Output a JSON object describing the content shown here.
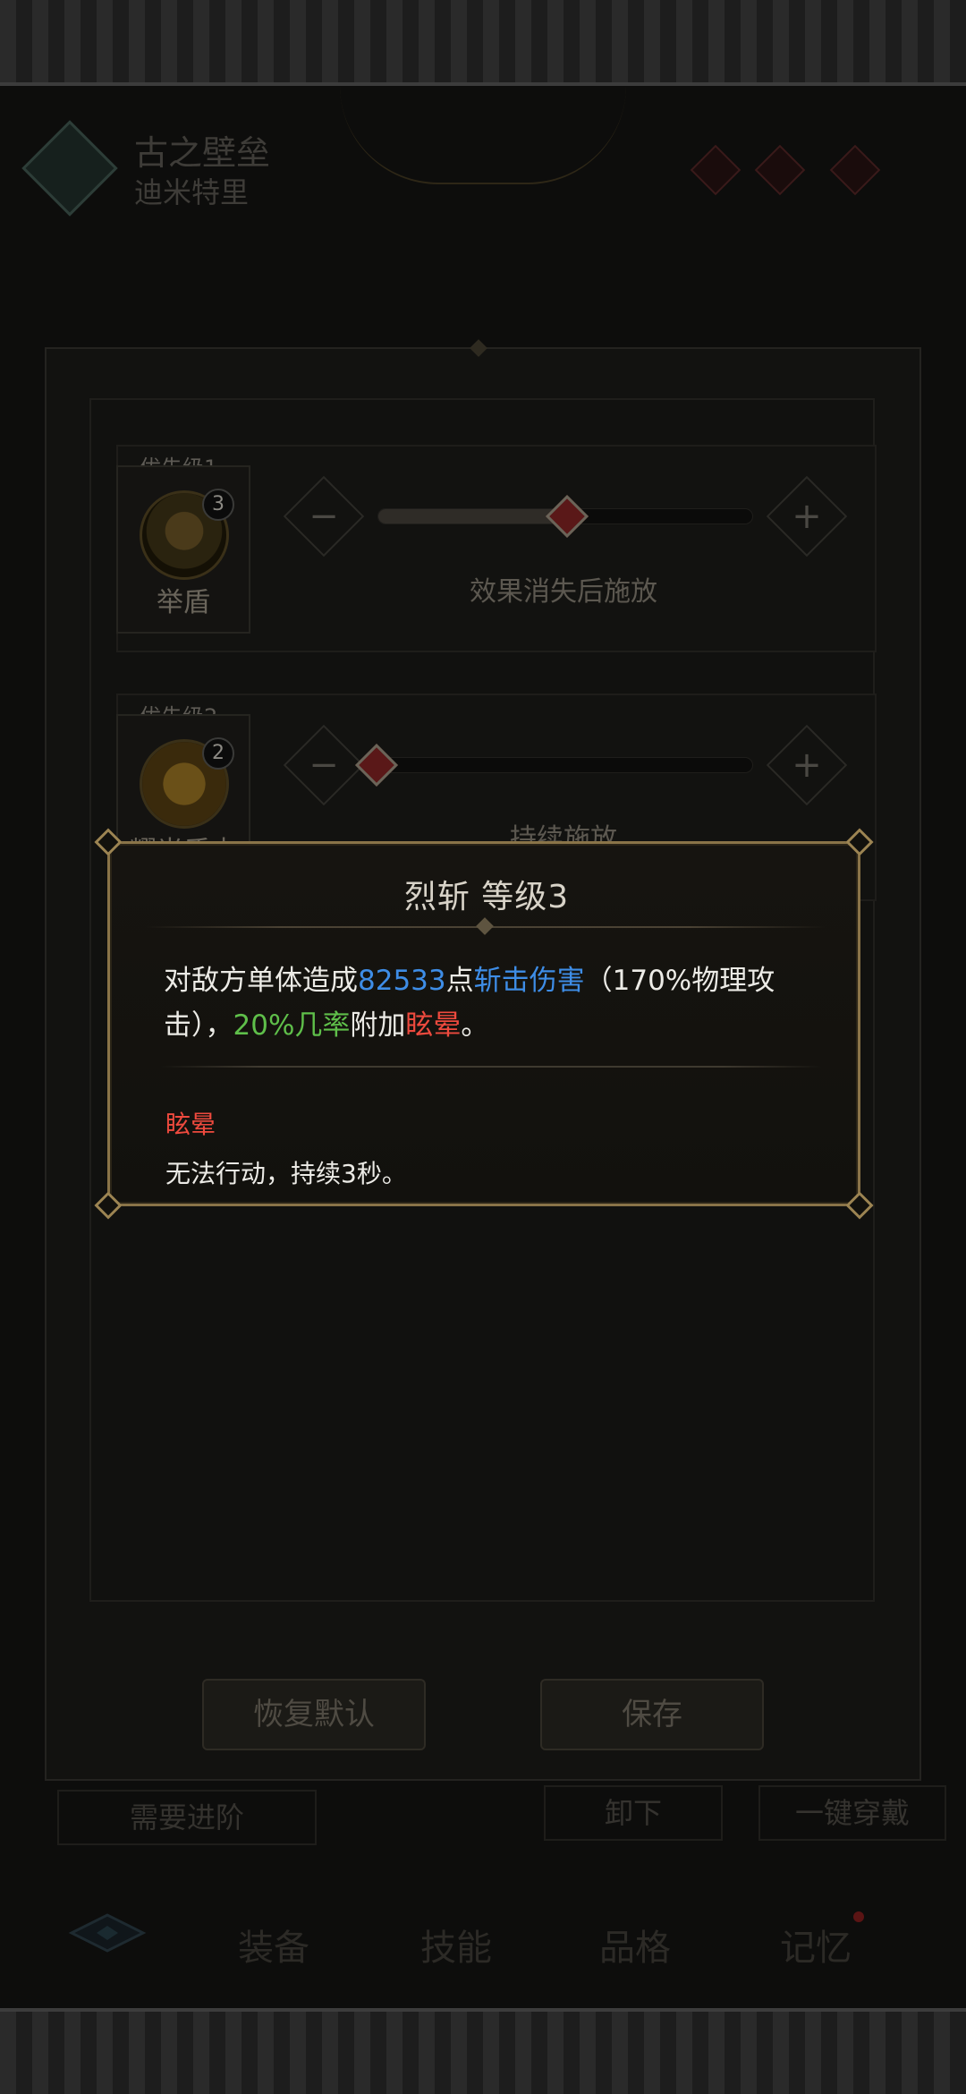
{
  "hero": {
    "title": "古之壁垒",
    "subtitle": "迪米特里"
  },
  "skills": [
    {
      "priority_label": "优先级1",
      "name": "举盾",
      "level": "3",
      "minus": "−",
      "plus": "+",
      "condition": "效果消失后施放",
      "slider_fraction": 0.52
    },
    {
      "priority_label": "优先级2",
      "name": "耀光盾击",
      "level": "2",
      "minus": "−",
      "plus": "+",
      "condition": "持续施放",
      "slider_fraction": 0.0
    }
  ],
  "panel_buttons": {
    "reset": "恢复默认",
    "save": "保存"
  },
  "background_buttons": {
    "advance": "需要进阶",
    "unequip": "卸下",
    "equip_all": "一键穿戴"
  },
  "nav": {
    "tabs": [
      "装备",
      "技能",
      "品格",
      "记忆"
    ]
  },
  "popup": {
    "title": "烈斩  等级3",
    "desc_parts": {
      "p1": "对敌方单体造成",
      "damage": "82533",
      "p2": "点",
      "damage_type": "斩击伤害",
      "p3": "（170%物理攻击），",
      "chance": "20%几率",
      "p4": "附加",
      "status": "眩晕",
      "p5": "。"
    },
    "status_name": "眩晕",
    "status_desc": "无法行动，持续3秒。"
  },
  "colors": {
    "blue": "#3e8de6",
    "green": "#5fbf4a",
    "red": "#ee4a3e",
    "gold_border": "#8a7448"
  }
}
